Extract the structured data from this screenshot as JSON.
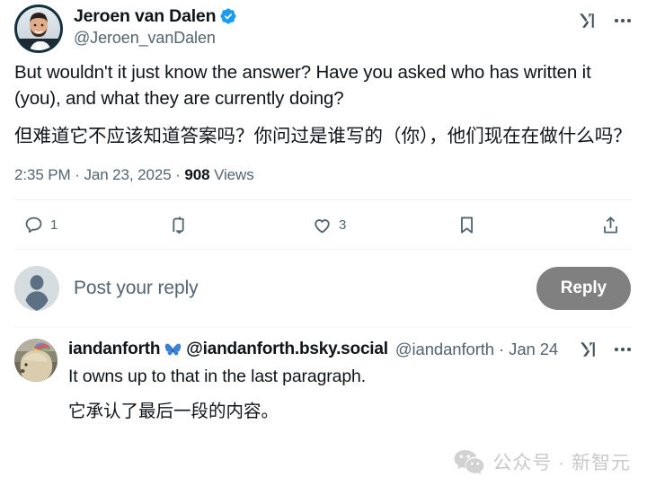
{
  "tweet": {
    "author": {
      "display_name": "Jeroen van Dalen",
      "handle": "@Jeroen_vanDalen",
      "verified_badge_icon": "verified-badge-icon",
      "verified_color": "#1D9BF0",
      "avatar_icon": "avatar-photo-man"
    },
    "header_actions": {
      "grok_icon": "grok-icon",
      "more_icon": "more-options-icon"
    },
    "body": {
      "paragraph_en": "But wouldn't it just know the answer? Have you  asked who has written it (you), and what they are currently doing?",
      "paragraph_zh": "但难道它不应该知道答案吗？你问过是谁写的（你），他们现在在做什么吗？"
    },
    "meta": {
      "time": "2:35 PM",
      "separator": "·",
      "date": "Jan 23, 2025",
      "views_count": "908",
      "views_label": "Views"
    },
    "actions": {
      "reply": {
        "icon": "reply-icon",
        "count": "1"
      },
      "retweet": {
        "icon": "retweet-icon",
        "count": ""
      },
      "like": {
        "icon": "like-heart-icon",
        "count": "3"
      },
      "bookmark": {
        "icon": "bookmark-icon",
        "count": ""
      },
      "share": {
        "icon": "share-icon",
        "count": ""
      }
    }
  },
  "composer": {
    "avatar_icon": "default-avatar-icon",
    "placeholder": "Post your reply",
    "reply_button_label": "Reply",
    "reply_button_color": "#808080"
  },
  "reply": {
    "author": {
      "display_name": "iandanforth",
      "bluesky_icon": "bluesky-butterfly-icon",
      "bluesky_handle": "@iandanforth.bsky.social",
      "handle": "@iandanforth",
      "separator": "·",
      "date": "Jan 24",
      "avatar_icon": "avatar-photo-dog"
    },
    "header_actions": {
      "grok_icon": "grok-icon",
      "more_icon": "more-options-icon"
    },
    "body": {
      "line_en": "It owns up to that in the last paragraph.",
      "line_zh": "它承认了最后一段的内容。"
    }
  },
  "watermark": {
    "icon": "wechat-icon",
    "text": "公众号 · 新智元",
    "color": "#c9c9c9"
  }
}
